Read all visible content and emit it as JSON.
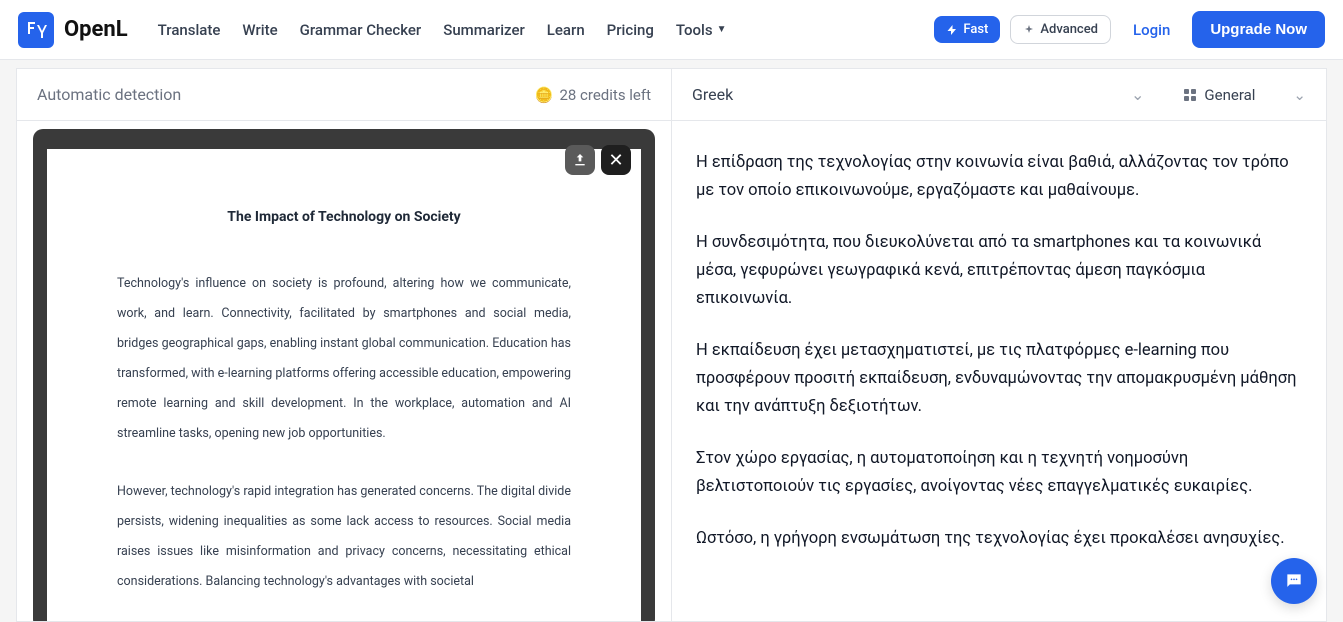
{
  "brand": {
    "name": "OpenL"
  },
  "nav": {
    "translate": "Translate",
    "write": "Write",
    "grammar": "Grammar Checker",
    "summarizer": "Summarizer",
    "learn": "Learn",
    "pricing": "Pricing",
    "tools": "Tools"
  },
  "header": {
    "fast": "Fast",
    "advanced": "Advanced",
    "login": "Login",
    "upgrade": "Upgrade Now"
  },
  "source": {
    "detection": "Automatic detection",
    "credits_emoji": "🪙",
    "credits": "28 credits left"
  },
  "target": {
    "language": "Greek",
    "style": "General"
  },
  "document": {
    "title": "The Impact of Technology on Society",
    "p1": "Technology's influence on society is profound, altering how we communicate, work, and learn. Connectivity, facilitated by smartphones and social media, bridges geographical gaps, enabling instant global communication. Education has transformed, with e-learning platforms offering accessible education, empowering remote learning and skill development. In the workplace, automation and AI streamline tasks, opening new job opportunities.",
    "p2": "However, technology's rapid integration has generated concerns. The digital divide persists, widening inequalities as some lack access to resources. Social media raises issues like misinformation and privacy concerns, necessitating ethical considerations. Balancing technology's advantages with societal"
  },
  "output": {
    "p1": "Η επίδραση της τεχνολογίας στην κοινωνία είναι βαθιά, αλλάζοντας τον τρόπο με τον οποίο επικοινωνούμε, εργαζόμαστε και μαθαίνουμε.",
    "p2": "Η συνδεσιμότητα, που διευκολύνεται από τα smartphones και τα κοινωνικά μέσα, γεφυρώνει γεωγραφικά κενά, επιτρέποντας άμεση παγκόσμια επικοινωνία.",
    "p3": "Η εκπαίδευση έχει μετασχηματιστεί, με τις πλατφόρμες e-learning που προσφέρουν προσιτή εκπαίδευση, ενδυναμώνοντας την απομακρυσμένη μάθηση και την ανάπτυξη δεξιοτήτων.",
    "p4": "Στον χώρο εργασίας, η αυτοματοποίηση και η τεχνητή νοημοσύνη βελτιστοποιούν τις εργασίες, ανοίγοντας νέες επαγγελματικές ευκαιρίες.",
    "p5": "Ωστόσο, η γρήγορη ενσωμάτωση της τεχνολογίας έχει προκαλέσει ανησυχίες."
  }
}
